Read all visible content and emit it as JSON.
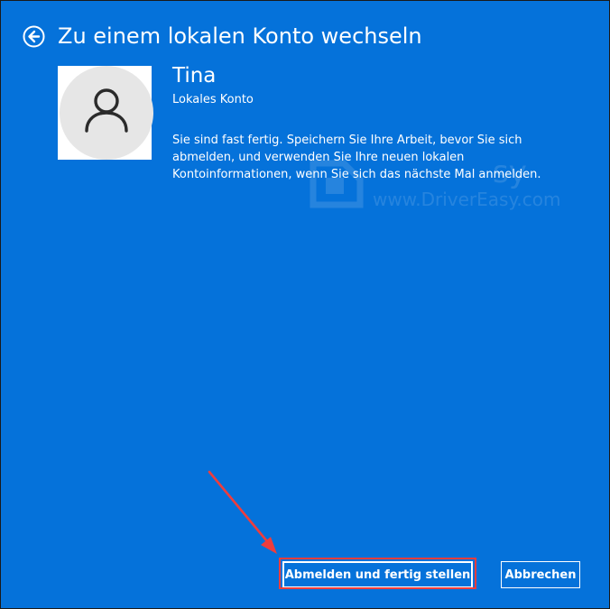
{
  "header": {
    "title": "Zu einem lokalen Konto wechseln",
    "back_icon": "back-arrow-circle-icon"
  },
  "account": {
    "avatar_icon": "user-avatar-icon",
    "name": "Tina",
    "type": "Lokales Konto",
    "message": "Sie sind fast fertig. Speichern Sie Ihre Arbeit, bevor Sie sich abmelden, und verwenden Sie Ihre neuen lokalen Kontoinformationen, wenn Sie sich das nächste Mal anmelden."
  },
  "buttons": {
    "primary_label": "Abmelden und fertig stellen",
    "cancel_label": "Abbrechen"
  },
  "watermark": {
    "brand": "sy",
    "url": "www.DriverEasy.com"
  },
  "colors": {
    "background": "#0572da",
    "text": "#ffffff",
    "highlight": "#ee3d3d",
    "avatar_bg": "#e6e6e6"
  }
}
